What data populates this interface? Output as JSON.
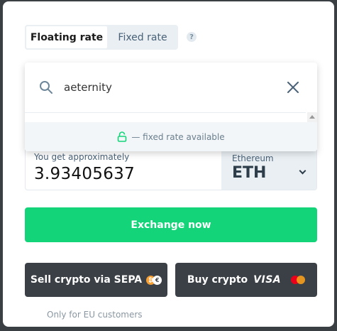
{
  "tabs": {
    "floating_label": "Floating rate",
    "fixed_label": "Fixed rate",
    "help_label": "?"
  },
  "search": {
    "value": "aeternity",
    "placeholder": "",
    "fixed_rate_note": "— fixed rate available"
  },
  "receive": {
    "label": "You get approximately",
    "amount": "3.93405637",
    "currency_name": "Ethereum",
    "currency_code": "ETH"
  },
  "buttons": {
    "exchange": "Exchange now",
    "sell_sepa": "Sell crypto via SEPA",
    "buy_crypto": "Buy crypto",
    "visa": "VISA"
  },
  "notes": {
    "eu_only": "Only for EU customers"
  },
  "colors": {
    "accent_green": "#13d479",
    "dark_button": "#3a4046",
    "tab_bg": "#e9eff3"
  },
  "icons": {
    "search": "search-icon",
    "clear": "close-icon",
    "lock": "lock-icon",
    "chevron": "chevron-down-icon",
    "mastercard": "mastercard-icon",
    "coins": "bitcoin-euro-icon"
  }
}
